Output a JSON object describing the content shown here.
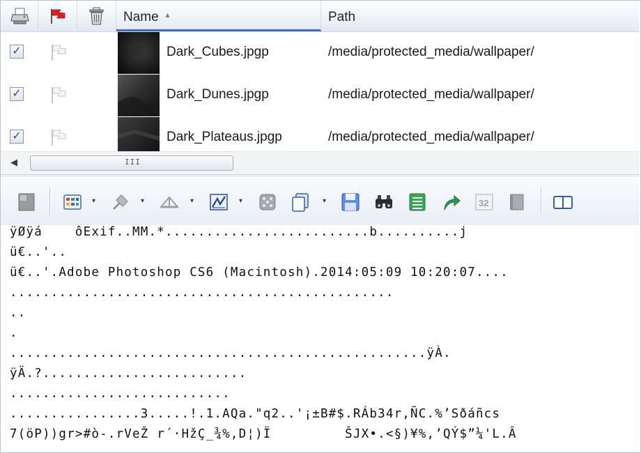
{
  "list": {
    "columns": {
      "name": "Name",
      "path": "Path"
    },
    "sort_indicator": "▲",
    "header_icons": [
      "printer-icon",
      "red-flag-icon",
      "trash-icon"
    ],
    "rows": [
      {
        "name": "Dark_Cubes.jpgp",
        "path": "/media/protected_media/wallpaper/",
        "checked": true
      },
      {
        "name": "Dark_Dunes.jpgp",
        "path": "/media/protected_media/wallpaper/",
        "checked": true
      },
      {
        "name": "Dark_Plateaus.jpgp",
        "path": "/media/protected_media/wallpaper/",
        "checked": true
      }
    ],
    "check_glyph": "✓"
  },
  "scrollbar": {
    "left_arrow": "◀",
    "grip": "III"
  },
  "toolbar": {
    "icons": [
      "page-icon",
      "grid-view-icon",
      "pin-icon",
      "bridge-icon",
      "chart-icon",
      "dice-icon",
      "copy-icon",
      "save-icon",
      "binoculars-icon",
      "list-icon",
      "redo-arrow-icon",
      "number-32-icon",
      "book-icon",
      "split-view-icon"
    ],
    "dropdown_glyph": "▾",
    "number_icon_text": "32"
  },
  "dump": {
    "lines": [
      "ÿØÿá    ôExif..MM.*.........................b..........j",
      "ü€..'..",
      "ü€..'.Adobe Photoshop CS6 (Macintosh).2014:05:09 10:20:07....",
      "...............................................",
      "..",
      ".",
      "...................................................ÿÀ.",
      "ÿÄ.?.........................",
      "...........................",
      "................3.....!.1.AQa.\"q2..'¡±B#$.RÁb34r,ÑC.%’Sðáñcs",
      "7(öP))gr>#ò-.rVeŽ r´·HžÇ_¾%,D¦)Ï         ŠJX•.<§)¥%,’QÝ$”¼'L.Â"
    ]
  }
}
